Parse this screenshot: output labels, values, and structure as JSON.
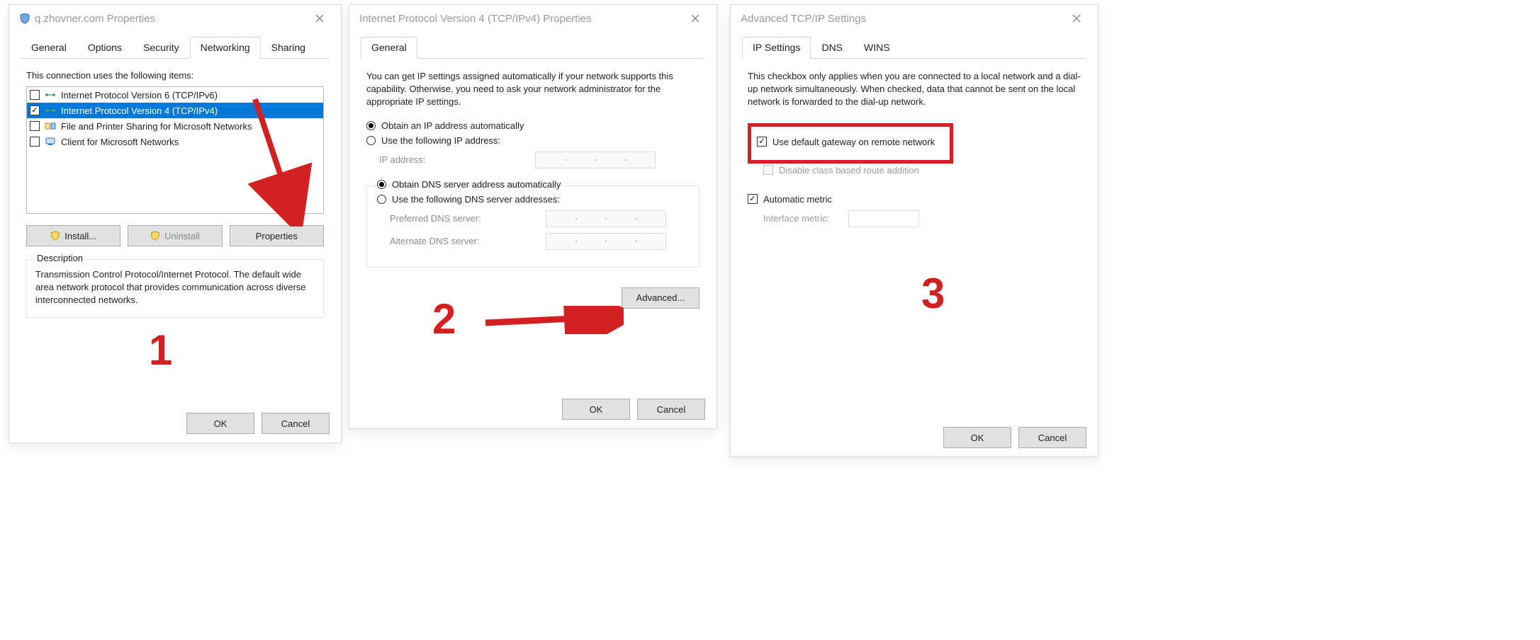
{
  "annotations": {
    "num1": "1",
    "num2": "2",
    "num3": "3"
  },
  "dlg1": {
    "title": "q.zhovner.com Properties",
    "tabs": [
      "General",
      "Options",
      "Security",
      "Networking",
      "Sharing"
    ],
    "active_tab": 3,
    "list_label": "This connection uses the following items:",
    "items": [
      {
        "checked": false,
        "label": "Internet Protocol Version 6 (TCP/IPv6)",
        "selected": false,
        "svg": "proto"
      },
      {
        "checked": true,
        "label": "Internet Protocol Version 4 (TCP/IPv4)",
        "selected": true,
        "svg": "proto"
      },
      {
        "checked": false,
        "label": "File and Printer Sharing for Microsoft Networks",
        "selected": false,
        "svg": "share"
      },
      {
        "checked": false,
        "label": "Client for Microsoft Networks",
        "selected": false,
        "svg": "client"
      }
    ],
    "btn_install": "Install...",
    "btn_uninstall": "Uninstall",
    "btn_properties": "Properties",
    "desc_legend": "Description",
    "desc_text": "Transmission Control Protocol/Internet Protocol. The default wide area network protocol that provides communication across diverse interconnected networks.",
    "ok": "OK",
    "cancel": "Cancel"
  },
  "dlg2": {
    "title": "Internet Protocol Version 4 (TCP/IPv4) Properties",
    "tabs": [
      "General"
    ],
    "active_tab": 0,
    "intro": "You can get IP settings assigned automatically if your network supports this capability. Otherwise, you need to ask your network administrator for the appropriate IP settings.",
    "r_ip_auto": "Obtain an IP address automatically",
    "r_ip_manual": "Use the following IP address:",
    "ip_label": "IP address:",
    "r_dns_auto": "Obtain DNS server address automatically",
    "r_dns_manual": "Use the following DNS server addresses:",
    "dns_pref": "Preferred DNS server:",
    "dns_alt": "Alternate DNS server:",
    "advanced": "Advanced...",
    "ok": "OK",
    "cancel": "Cancel"
  },
  "dlg3": {
    "title": "Advanced TCP/IP Settings",
    "tabs": [
      "IP Settings",
      "DNS",
      "WINS"
    ],
    "active_tab": 0,
    "intro": "This checkbox only applies when you are connected to a local network and a dial-up network simultaneously.  When checked, data that cannot be sent on the local network is forwarded to the dial-up network.",
    "chk_gateway": "Use default gateway on remote network",
    "chk_gateway_checked": true,
    "chk_classroute": "Disable class based route addition",
    "chk_metric": "Automatic metric",
    "chk_metric_checked": true,
    "metric_label": "Interface metric:",
    "ok": "OK",
    "cancel": "Cancel"
  }
}
